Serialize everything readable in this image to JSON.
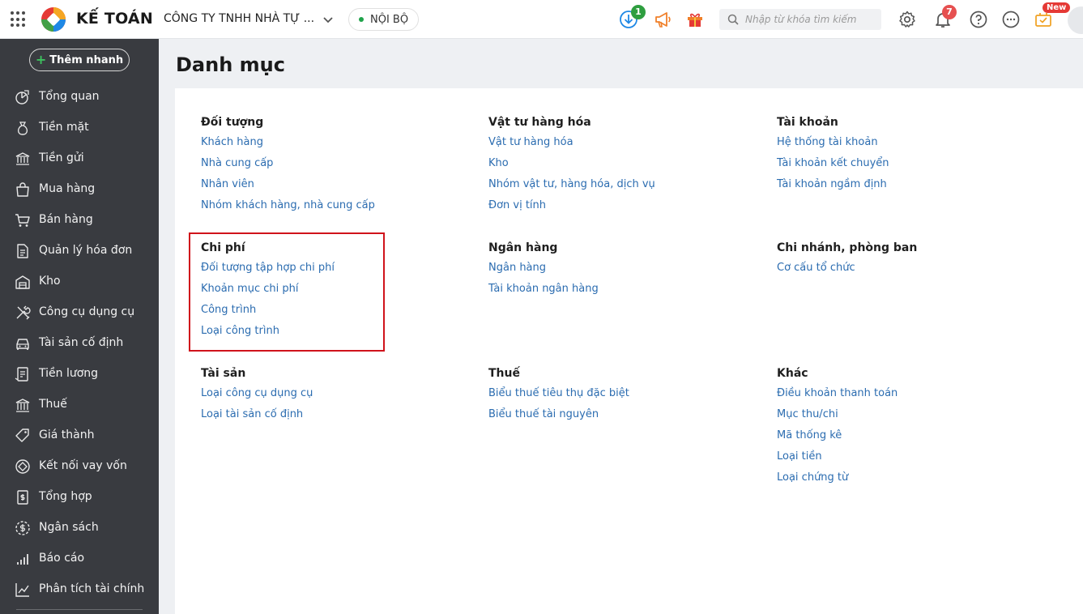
{
  "header": {
    "brand": "KẾ TOÁN",
    "company": "CÔNG TY TNHH NHÀ TỰ ...",
    "environment": "NỘI BỘ",
    "download_badge": "1",
    "notification_badge": "7",
    "new_badge": "New",
    "search_placeholder": "Nhập từ khóa tìm kiếm",
    "colors": {
      "accent": "#1e88e5",
      "badge_green": "#2e9e3f",
      "badge_red": "#e65050",
      "megaphone": "#f0802a"
    }
  },
  "sidebar": {
    "quick_add": "Thêm nhanh",
    "items": [
      {
        "label": "Tổng quan",
        "icon": "dashboard-icon"
      },
      {
        "label": "Tiền mặt",
        "icon": "money-bag-icon"
      },
      {
        "label": "Tiền gửi",
        "icon": "bank-icon"
      },
      {
        "label": "Mua hàng",
        "icon": "shopping-bag-icon"
      },
      {
        "label": "Bán hàng",
        "icon": "cart-icon"
      },
      {
        "label": "Quản lý hóa đơn",
        "icon": "invoice-icon"
      },
      {
        "label": "Kho",
        "icon": "warehouse-icon"
      },
      {
        "label": "Công cụ dụng cụ",
        "icon": "tools-icon"
      },
      {
        "label": "Tài sản cố định",
        "icon": "car-icon"
      },
      {
        "label": "Tiền lương",
        "icon": "salary-icon"
      },
      {
        "label": "Thuế",
        "icon": "tax-building-icon"
      },
      {
        "label": "Giá thành",
        "icon": "price-tag-icon"
      },
      {
        "label": "Kết nối vay vốn",
        "icon": "loan-icon"
      },
      {
        "label": "Tổng hợp",
        "icon": "ledger-icon"
      },
      {
        "label": "Ngân sách",
        "icon": "budget-icon"
      },
      {
        "label": "Báo cáo",
        "icon": "bar-chart-icon"
      },
      {
        "label": "Phân tích tài chính",
        "icon": "analysis-icon"
      }
    ]
  },
  "main": {
    "title": "Danh mục",
    "groups": [
      {
        "title": "Đối tượng",
        "links": [
          "Khách hàng",
          "Nhà cung cấp",
          "Nhân viên",
          "Nhóm khách hàng, nhà cung cấp"
        ]
      },
      {
        "title": "Vật tư hàng hóa",
        "links": [
          "Vật tư hàng hóa",
          "Kho",
          "Nhóm vật tư, hàng hóa, dịch vụ",
          "Đơn vị tính"
        ]
      },
      {
        "title": "Tài khoản",
        "links": [
          "Hệ thống tài khoản",
          "Tài khoản kết chuyển",
          "Tài khoản ngầm định"
        ]
      },
      {
        "title": "Chi phí",
        "links": [
          "Đối tượng tập hợp chi phí",
          "Khoản mục chi phí",
          "Công trình",
          "Loại công trình"
        ]
      },
      {
        "title": "Ngân hàng",
        "links": [
          "Ngân hàng",
          "Tài khoản ngân hàng"
        ]
      },
      {
        "title": "Chi nhánh, phòng ban",
        "links": [
          "Cơ cấu tổ chức"
        ]
      },
      {
        "title": "Tài sản",
        "links": [
          "Loại công cụ dụng cụ",
          "Loại tài sản cố định"
        ]
      },
      {
        "title": "Thuế",
        "links": [
          "Biểu thuế tiêu thụ đặc biệt",
          "Biểu thuế tài nguyên"
        ]
      },
      {
        "title": "Khác",
        "links": [
          "Điều khoản thanh toán",
          "Mục thu/chi",
          "Mã thống kê",
          "Loại tiền",
          "Loại chứng từ"
        ]
      }
    ]
  }
}
